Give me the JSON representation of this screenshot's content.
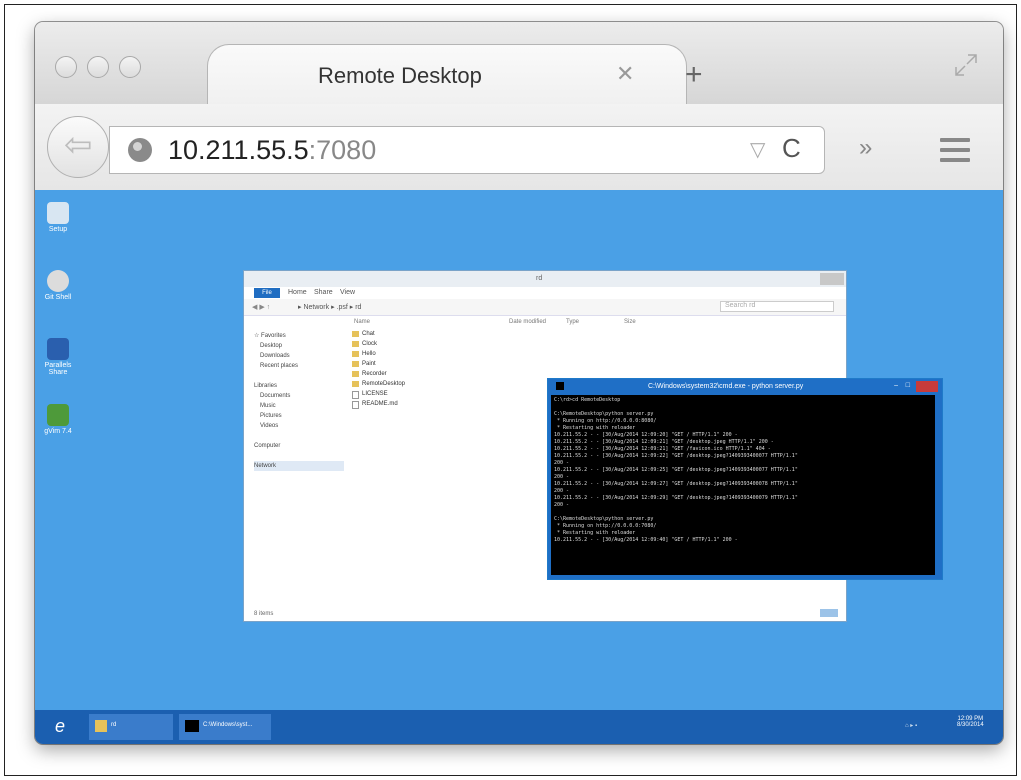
{
  "browser": {
    "tab_title": "Remote Desktop",
    "tab_close": "✕",
    "new_tab": "+",
    "url_host": "10.211.55.5",
    "url_port": ":7080",
    "dropdown_glyph": "▽",
    "reload_glyph": "C",
    "overflow_glyph": "»",
    "back_glyph": "⇦"
  },
  "desktop": {
    "icons": [
      {
        "label": "Setup",
        "color": "#d8e6f2"
      },
      {
        "label": "Git Shell",
        "color": "#dcdcdc"
      },
      {
        "label": "Parallels Share",
        "color": "#2a5fae"
      },
      {
        "label": "gVim 7.4",
        "color": "#4e9a3a"
      }
    ]
  },
  "explorer": {
    "title": "rd",
    "tabs": [
      "File",
      "Home",
      "Share",
      "View"
    ],
    "address": "▸ Network ▸ .psf ▸ rd",
    "search": "Search rd",
    "columns": [
      "Name",
      "Date modified",
      "Type",
      "Size"
    ],
    "nav": [
      "☆ Favorites",
      "Desktop",
      "Downloads",
      "Recent places",
      "",
      "Libraries",
      "Documents",
      "Music",
      "Pictures",
      "Videos",
      "",
      "Computer",
      "",
      "Network"
    ],
    "files": [
      {
        "name": "Chat",
        "kind": "folder"
      },
      {
        "name": "Clock",
        "kind": "folder"
      },
      {
        "name": "Hello",
        "kind": "folder"
      },
      {
        "name": "Paint",
        "kind": "folder"
      },
      {
        "name": "Recorder",
        "kind": "folder"
      },
      {
        "name": "RemoteDesktop",
        "kind": "folder"
      },
      {
        "name": "LICENSE",
        "kind": "file"
      },
      {
        "name": "README.md",
        "kind": "file"
      }
    ],
    "status": "8 items"
  },
  "cmd": {
    "title": "C:\\Windows\\system32\\cmd.exe - python  server.py",
    "text": "C:\\rd>cd RemoteDesktop\n\nC:\\RemoteDesktop\\python server.py\n * Running on http://0.0.0.0:8080/\n * Restarting with reloader\n10.211.55.2 - - [30/Aug/2014 12:09:20] \"GET / HTTP/1.1\" 200 -\n10.211.55.2 - - [30/Aug/2014 12:09:21] \"GET /desktop.jpeg HTTP/1.1\" 200 -\n10.211.55.2 - - [30/Aug/2014 12:09:21] \"GET /favicon.ico HTTP/1.1\" 404 -\n10.211.55.2 - - [30/Aug/2014 12:09:22] \"GET /desktop.jpeg?1409393400077 HTTP/1.1\"\n200 -\n10.211.55.2 - - [30/Aug/2014 12:09:25] \"GET /desktop.jpeg?1409393400077 HTTP/1.1\"\n200 -\n10.211.55.2 - - [30/Aug/2014 12:09:27] \"GET /desktop.jpeg?1409393400078 HTTP/1.1\"\n200 -\n10.211.55.2 - - [30/Aug/2014 12:09:29] \"GET /desktop.jpeg?1409393400079 HTTP/1.1\"\n200 -\n\nC:\\RemoteDesktop\\python server.py\n * Running on http://0.0.0.0:7080/\n * Restarting with reloader\n10.211.55.2 - - [30/Aug/2014 12:09:40] \"GET / HTTP/1.1\" 200 -"
  },
  "taskbar": {
    "explorer_label": "rd",
    "cmd_label": "C:\\Windows\\syst...",
    "time": "12:09 PM",
    "date": "8/30/2014"
  }
}
